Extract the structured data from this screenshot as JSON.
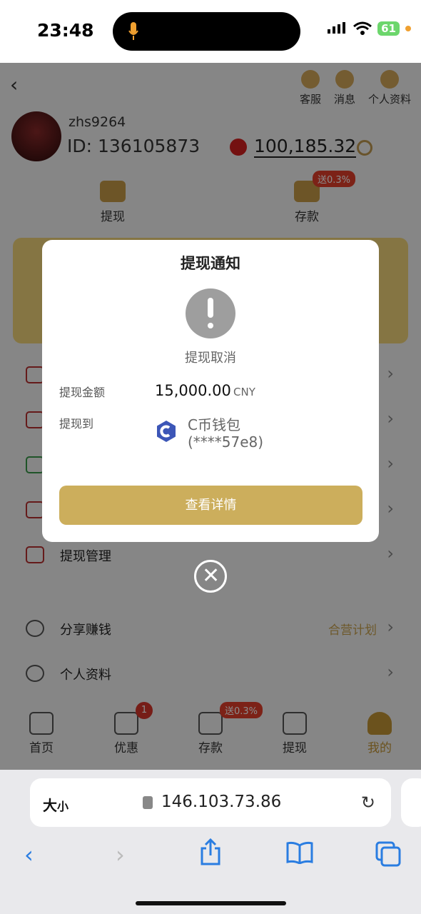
{
  "status_bar": {
    "time": "23:48",
    "battery": "61"
  },
  "header": {
    "actions": [
      {
        "label": "客服",
        "icon": "headset-icon"
      },
      {
        "label": "消息",
        "icon": "message-icon"
      },
      {
        "label": "个人资料",
        "icon": "profile-settings-icon"
      }
    ]
  },
  "profile": {
    "username": "zhs9264",
    "id_label": "ID: 136105873",
    "balance": "100,185.32"
  },
  "quick_actions": {
    "withdraw": "提现",
    "deposit": "存款",
    "deposit_bonus": "送0.3%"
  },
  "menu": {
    "withdraw_manage": "提现管理",
    "share_earn": "分享赚钱",
    "share_earn_right": "合营计划",
    "personal_info": "个人资料"
  },
  "tabbar": {
    "home": "首页",
    "promo": "优惠",
    "promo_badge": "1",
    "deposit": "存款",
    "deposit_bonus": "送0.3%",
    "withdraw": "提现",
    "mine": "我的"
  },
  "modal": {
    "title": "提现通知",
    "status": "提现取消",
    "amount_label": "提现金额",
    "amount": "15,000.00",
    "currency": "CNY",
    "to_label": "提现到",
    "wallet_name": "C币钱包",
    "wallet_account": "(****57e8)",
    "details_button": "查看详情"
  },
  "browser": {
    "text_size": "大",
    "text_size_small": "小",
    "url": "146.103.73.86"
  },
  "colors": {
    "accent_gold": "#ccae5c",
    "badge_red": "#e23e2b",
    "alert_gray": "#9e9e9e"
  }
}
